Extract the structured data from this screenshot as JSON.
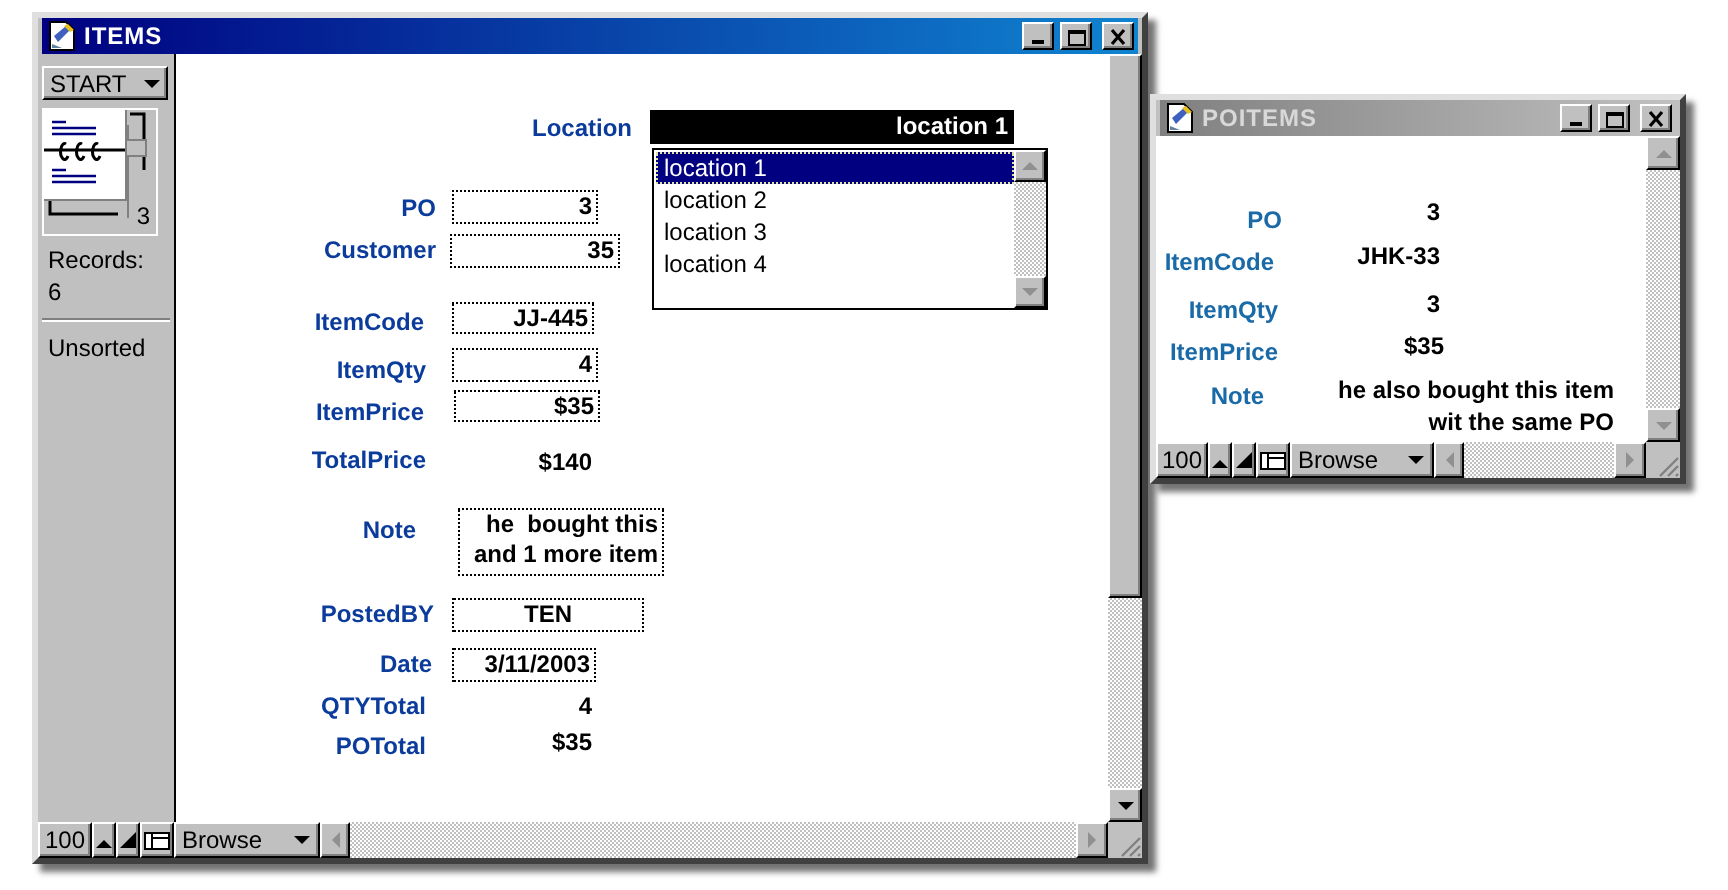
{
  "windows": [
    {
      "title": "ITEMS",
      "active": true,
      "sidebar": {
        "layout": "START",
        "record_number": "3",
        "records_label": "Records:",
        "records_count": "6",
        "sort_status": "Unsorted"
      },
      "location": {
        "label": "Location",
        "value": "location 1",
        "options": [
          {
            "label": "location 1",
            "selected": true
          },
          {
            "label": "location 2",
            "selected": false
          },
          {
            "label": "location 3",
            "selected": false
          },
          {
            "label": "location 4",
            "selected": false
          }
        ]
      },
      "fields": [
        {
          "label": "PO",
          "value": "3",
          "kind": "field"
        },
        {
          "label": "Customer",
          "value": "35",
          "kind": "field"
        },
        {
          "label": "ItemCode",
          "value": "JJ-445",
          "kind": "field"
        },
        {
          "label": "ItemQty",
          "value": "4",
          "kind": "field"
        },
        {
          "label": "ItemPrice",
          "value": "$35",
          "kind": "field"
        },
        {
          "label": "TotalPrice",
          "value": "$140",
          "kind": "display"
        },
        {
          "label": "Note",
          "value": "he  bought this\nand 1 more item",
          "kind": "field"
        },
        {
          "label": "PostedBY",
          "value": "TEN",
          "kind": "field"
        },
        {
          "label": "Date",
          "value": "3/11/2003",
          "kind": "field"
        },
        {
          "label": "QTYTotal",
          "value": "4",
          "kind": "display"
        },
        {
          "label": "POTotal",
          "value": "$35",
          "kind": "display"
        }
      ],
      "status_bar": {
        "zoom": "100",
        "mode": "Browse"
      }
    },
    {
      "title": "POITEMS",
      "active": false,
      "fields": [
        {
          "label": "PO",
          "value": "3",
          "kind": "display"
        },
        {
          "label": "ItemCode",
          "value": "JHK-33",
          "kind": "display"
        },
        {
          "label": "ItemQty",
          "value": "3",
          "kind": "display"
        },
        {
          "label": "ItemPrice",
          "value": "$35",
          "kind": "display"
        },
        {
          "label": "Note",
          "value": "he also bought this item\nwit the same PO",
          "kind": "display"
        }
      ],
      "status_bar": {
        "zoom": "100",
        "mode": "Browse"
      }
    }
  ]
}
